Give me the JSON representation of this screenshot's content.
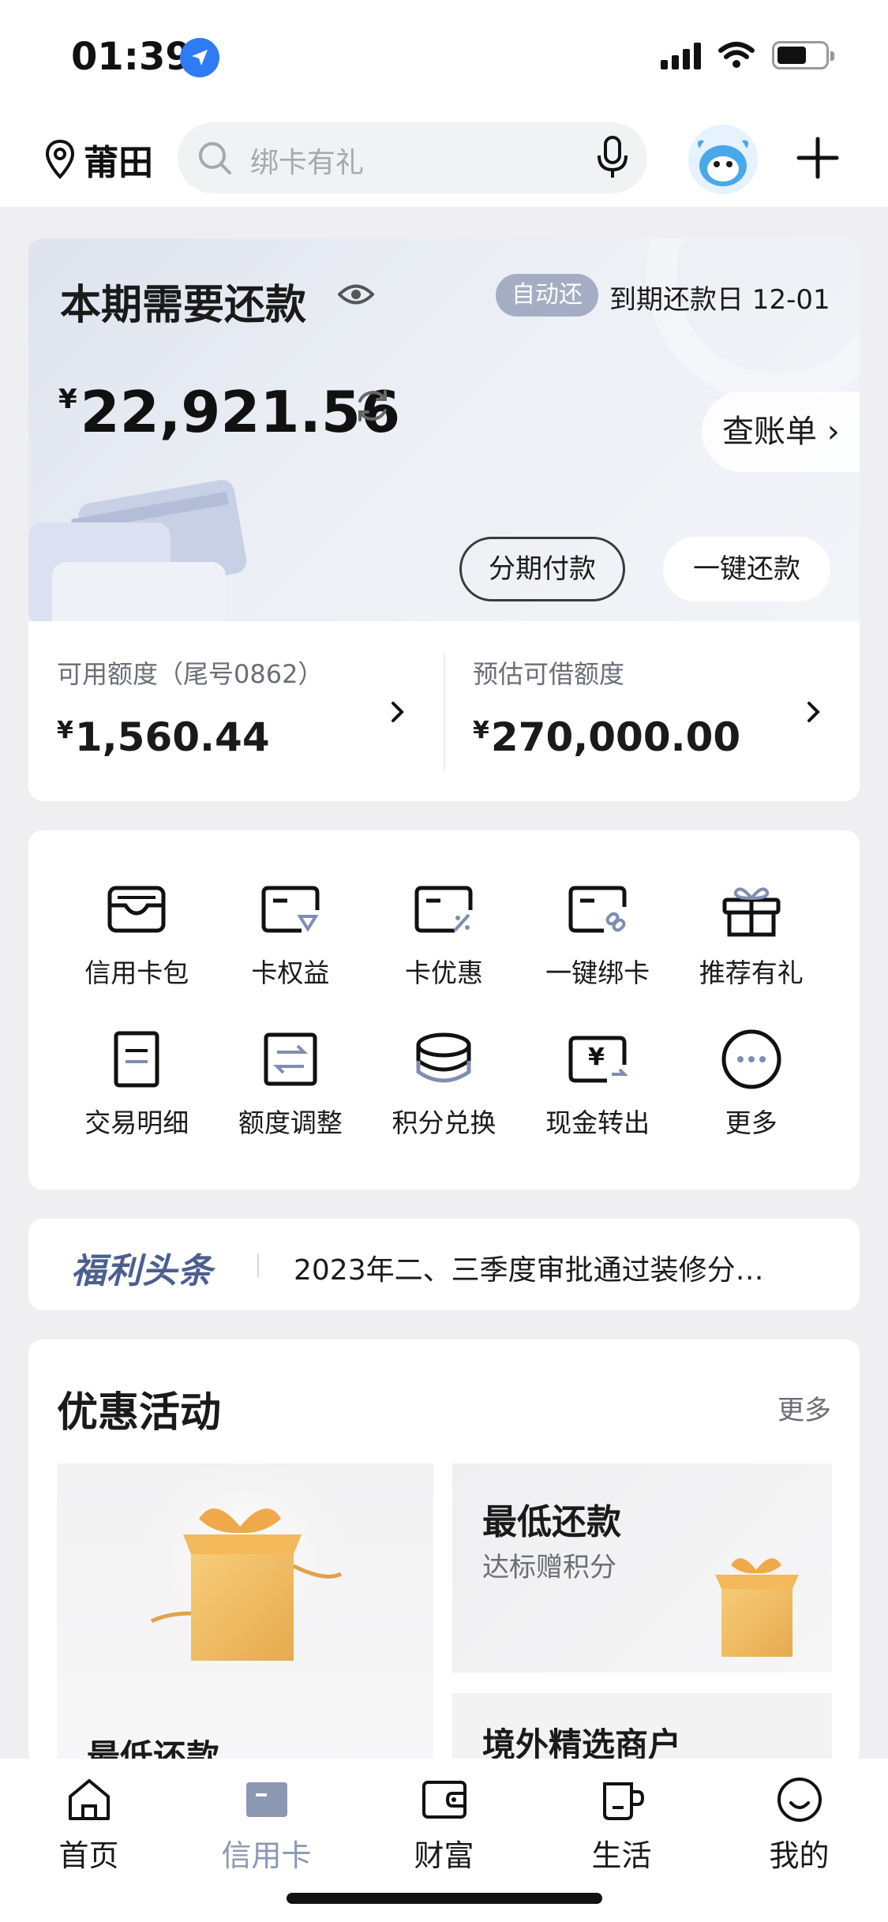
{
  "status_bar": {
    "time": "01:39"
  },
  "header": {
    "location": "莆田",
    "search": {
      "placeholder": "绑卡有礼"
    }
  },
  "bill": {
    "title": "本期需要还款",
    "auto_repay_badge": "自动还",
    "due_date": "到期还款日 12-01",
    "currency_symbol": "¥",
    "amount": "22,921.56",
    "check_bill_label": "查账单 ›",
    "installment_label": "分期付款",
    "one_click_repay_label": "一键还款"
  },
  "limits": [
    {
      "label": "可用额度（尾号0862）",
      "currency_symbol": "¥",
      "value": "1,560.44"
    },
    {
      "label": "预估可借额度",
      "currency_symbol": "¥",
      "value": "270,000.00"
    }
  ],
  "services": [
    {
      "label": "信用卡包",
      "icon": "card-wallet-icon"
    },
    {
      "label": "卡权益",
      "icon": "card-benefits-icon"
    },
    {
      "label": "卡优惠",
      "icon": "card-discount-icon"
    },
    {
      "label": "一键绑卡",
      "icon": "bind-card-icon"
    },
    {
      "label": "推荐有礼",
      "icon": "gift-icon"
    },
    {
      "label": "交易明细",
      "icon": "transaction-details-icon"
    },
    {
      "label": "额度调整",
      "icon": "limit-adjust-icon"
    },
    {
      "label": "积分兑换",
      "icon": "points-exchange-icon"
    },
    {
      "label": "现金转出",
      "icon": "cash-transfer-icon"
    },
    {
      "label": "更多",
      "icon": "more-icon"
    }
  ],
  "news": {
    "logo": "福利头条",
    "headline": "2023年二、三季度审批通过装修分…"
  },
  "promotions": {
    "title": "优惠活动",
    "more_label": "更多",
    "big_card_caption": "最低还款",
    "small_card_1": {
      "title": "最低还款",
      "subtitle": "达标赠积分"
    },
    "small_card_2": {
      "title": "境外精选商户"
    }
  },
  "tabbar": [
    {
      "label": "首页",
      "icon": "home-icon"
    },
    {
      "label": "信用卡",
      "icon": "credit-card-icon",
      "active": true
    },
    {
      "label": "财富",
      "icon": "wallet-icon"
    },
    {
      "label": "生活",
      "icon": "cup-icon"
    },
    {
      "label": "我的",
      "icon": "smile-icon"
    }
  ],
  "colors": {
    "accent_active_tab": "#8c97b4",
    "badge_bg": "#a4adc3",
    "news_logo": "#4b5f8f",
    "location_arrow": "#2f7bf5"
  }
}
